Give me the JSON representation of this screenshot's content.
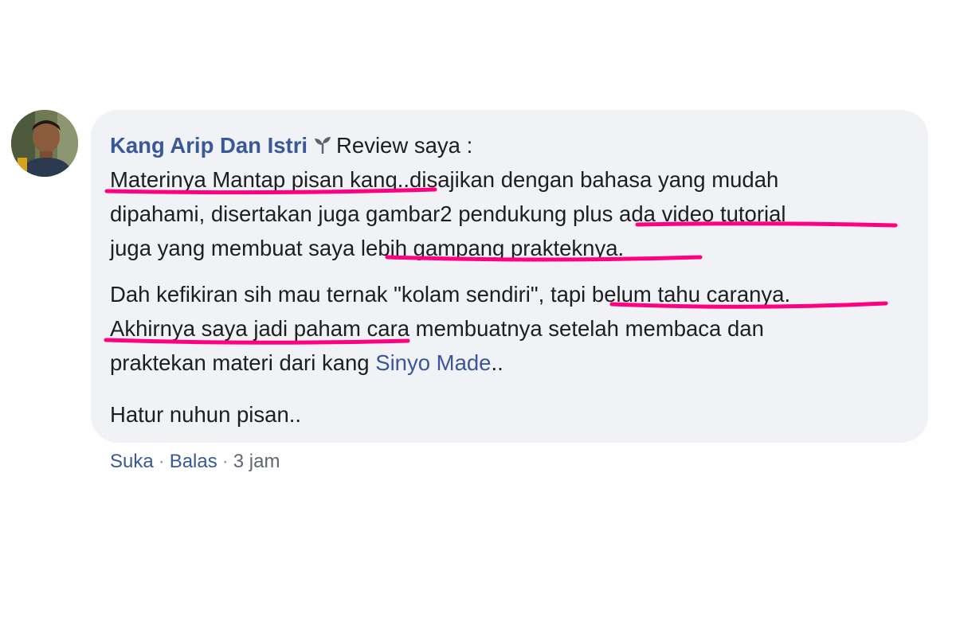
{
  "comment": {
    "author": "Kang Arip Dan Istri",
    "author_badge_icon": "sprout-icon",
    "intro": "Review saya :",
    "paragraph1": {
      "line1_highlight": "Materinya Mantap pisan kang",
      "line1_rest": "..disajikan dengan bahasa yang mudah",
      "line2_start": "dipahami, disertakan juga gambar2 pendukung ",
      "line2_highlight": "plus ada video tutorial",
      "line3_start": "juga yang membuat saya ",
      "line3_highlight": "lebih gampang prakteknya."
    },
    "paragraph2": {
      "line1_start": "Dah kefikiran sih mau ternak \"kolam sendiri\", ",
      "line1_highlight": "tapi belum tahu caranya.",
      "line2_highlight": "Akhirnya saya jadi paham",
      "line2_rest": " cara membuatnya setelah membaca dan",
      "line3_start": "praktekan materi dari kang ",
      "line3_link": "Sinyo Made",
      "line3_end": ".."
    },
    "closing": "Hatur nuhun pisan.."
  },
  "actions": {
    "like": "Suka",
    "separator": "·",
    "reply": "Balas",
    "time": "3 jam"
  },
  "colors": {
    "author_link": "#385898",
    "bubble_background": "#f1f2f6",
    "text": "#1c1e21",
    "meta_text": "#606770",
    "highlight_underline": "#ff0080"
  }
}
